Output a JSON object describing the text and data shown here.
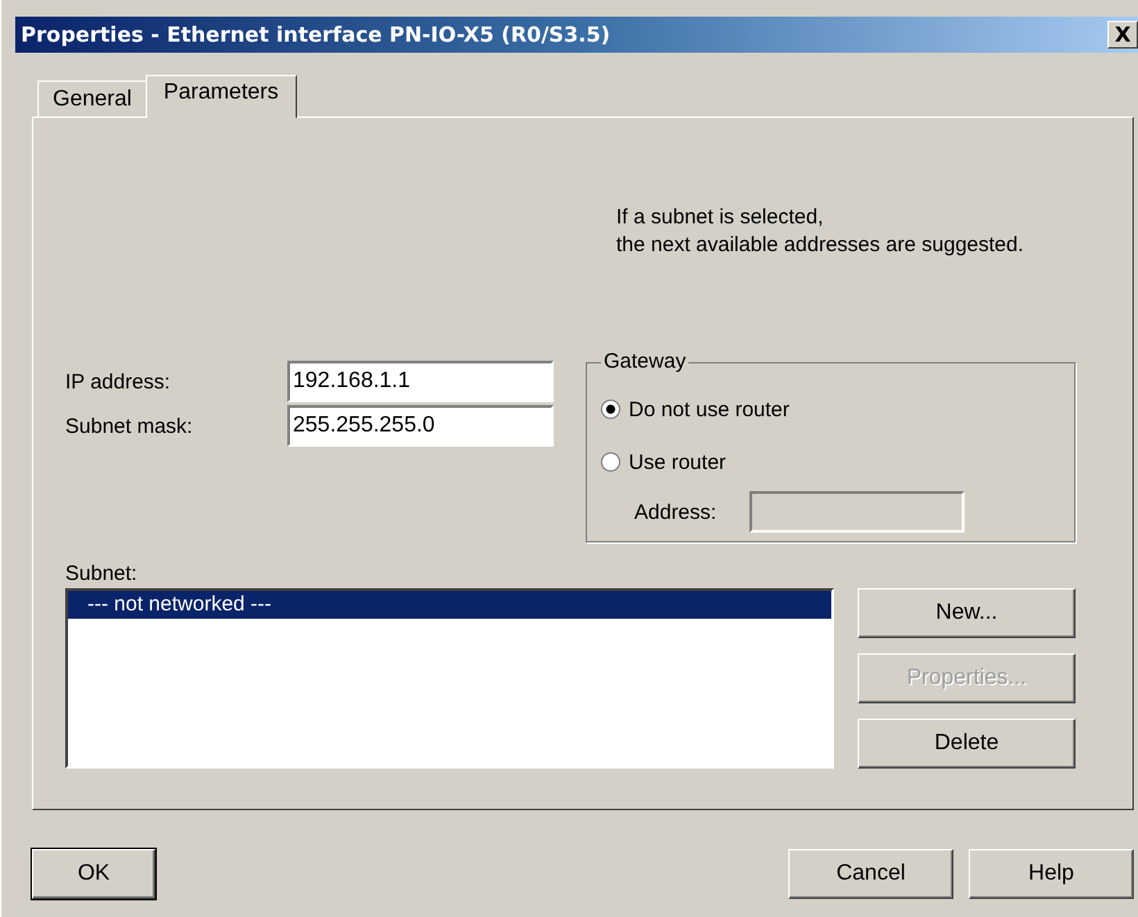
{
  "window": {
    "title": "Properties - Ethernet interface  PN-IO-X5 (R0/S3.5)",
    "close": "X"
  },
  "tabs": [
    {
      "label": "General",
      "selected": false
    },
    {
      "label": "Parameters",
      "selected": true
    }
  ],
  "hint": [
    "If a subnet is selected,",
    "the next available addresses are suggested."
  ],
  "fields": [
    {
      "label": "IP address:",
      "value": "192.168.1.1"
    },
    {
      "label": "Subnet mask:",
      "value": "255.255.255.0"
    }
  ],
  "gateway": {
    "title": "Gateway",
    "options": [
      {
        "label": "Do not use router",
        "selected": true
      },
      {
        "label": "Use router",
        "selected": false
      }
    ],
    "address": {
      "label": "Address:",
      "disabled": true
    }
  },
  "subnet": {
    "label": "Subnet:",
    "items": [
      {
        "label": "--- not networked ---",
        "selected": true
      }
    ]
  },
  "side_buttons": [
    {
      "label": "New...",
      "disabled": false
    },
    {
      "label": "Properties...",
      "disabled": true
    },
    {
      "label": "Delete",
      "disabled": false
    }
  ],
  "buttons": [
    {
      "label": "OK",
      "default": true
    },
    {
      "label": "Cancel",
      "default": false
    },
    {
      "label": "Help",
      "default": false
    }
  ]
}
